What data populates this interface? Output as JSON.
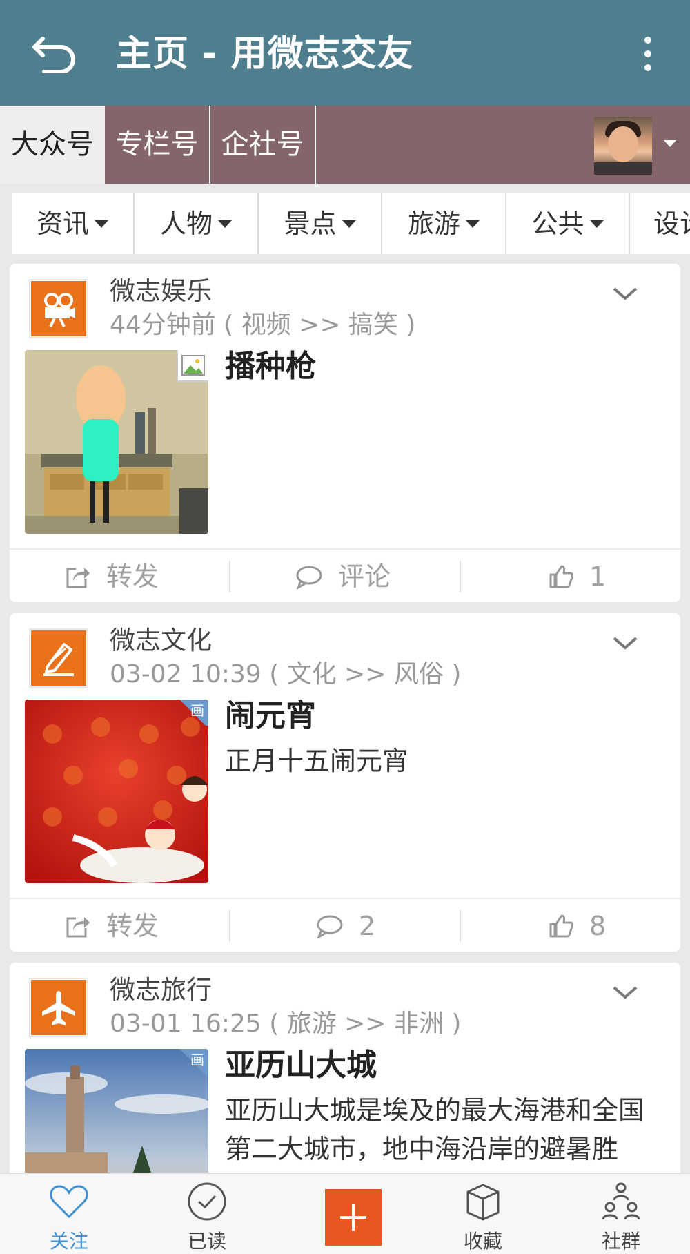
{
  "appbar": {
    "title": "主页 - 用微志交友"
  },
  "tabs": [
    "大众号",
    "专栏号",
    "企社号"
  ],
  "categories": [
    "资讯",
    "人物",
    "景点",
    "旅游",
    "公共",
    "设计"
  ],
  "posts": [
    {
      "source": "微志娱乐",
      "meta": "44分钟前 ( 视频 >> 搞笑 )",
      "title": "播种枪",
      "summary": "",
      "share_label": "转发",
      "comment_label": "评论",
      "likes": "1",
      "icon": "video-camera-icon"
    },
    {
      "source": "微志文化",
      "meta": "03-02 10:39 ( 文化 >> 风俗 )",
      "title": "闹元宵",
      "summary": "正月十五闹元宵",
      "share_label": "转发",
      "comment_label": "2",
      "likes": "8",
      "badge": "画",
      "icon": "pencil-icon"
    },
    {
      "source": "微志旅行",
      "meta": "03-01 16:25 ( 旅游 >> 非洲 )",
      "title": "亚历山大城",
      "summary": "亚历山大城是埃及的最大海港和全国第二大城市，地中海沿岸的避暑胜",
      "badge": "画",
      "icon": "airplane-icon"
    }
  ],
  "bottom_nav": [
    "关注",
    "已读",
    "收藏",
    "社群"
  ],
  "colors": {
    "appbar": "#4f7f8e",
    "tabs": "#846569",
    "accent": "#e8711a",
    "active_nav": "#3d8fd6"
  }
}
